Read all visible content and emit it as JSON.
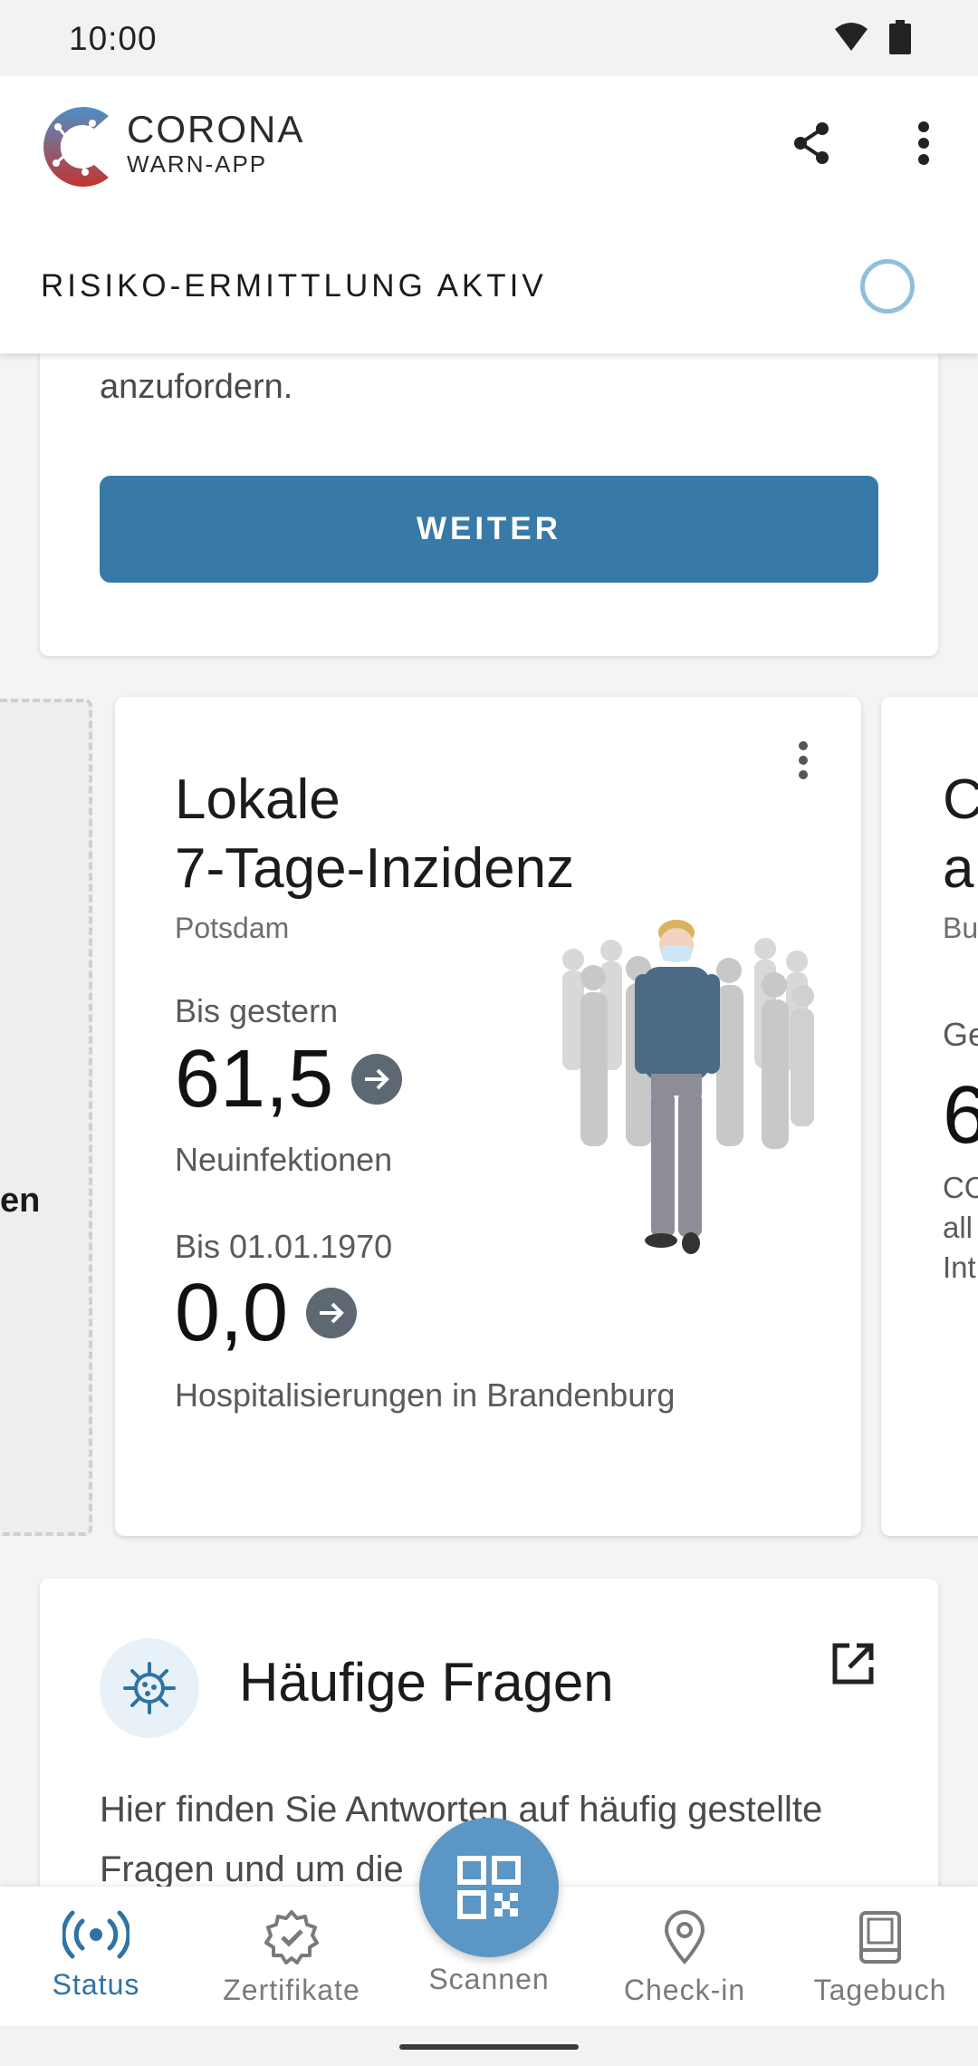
{
  "status_bar": {
    "time": "10:00"
  },
  "app": {
    "brand_line1": "CORONA",
    "brand_line2": "WARN-APP"
  },
  "risk": {
    "label": "RISIKO-ERMITTLUNG AKTIV"
  },
  "top_card": {
    "text": "anzufordern.",
    "button_label": "WEITER"
  },
  "placeholder_card": {
    "text": "en"
  },
  "incidence_card": {
    "title_line1": "Lokale",
    "title_line2": "7-Tage-Inzidenz",
    "location": "Potsdam",
    "primary_label": "Bis gestern",
    "primary_value": "61,5",
    "primary_sub": "Neuinfektionen",
    "secondary_label": "Bis 01.01.1970",
    "secondary_value": "0,0",
    "secondary_sub": "Hospitalisierungen in Brandenburg"
  },
  "next_card": {
    "title_line1": "C",
    "title_line2": "a",
    "subtitle": "Bu",
    "label": "Ge",
    "value": "6",
    "line1": "CO",
    "line2": "all",
    "line3": "Int"
  },
  "faq": {
    "title": "Häufige Fragen",
    "text": "Hier finden Sie Antworten auf häufig gestellte Fragen und um die"
  },
  "bottom_nav": {
    "items": [
      {
        "label": "Status"
      },
      {
        "label": "Zertifikate"
      },
      {
        "label": "Scannen"
      },
      {
        "label": "Check-in"
      },
      {
        "label": "Tagebuch"
      }
    ]
  },
  "colors": {
    "accent": "#377aa8",
    "nav_active": "#2e73a4",
    "fab": "#5b96c4"
  }
}
